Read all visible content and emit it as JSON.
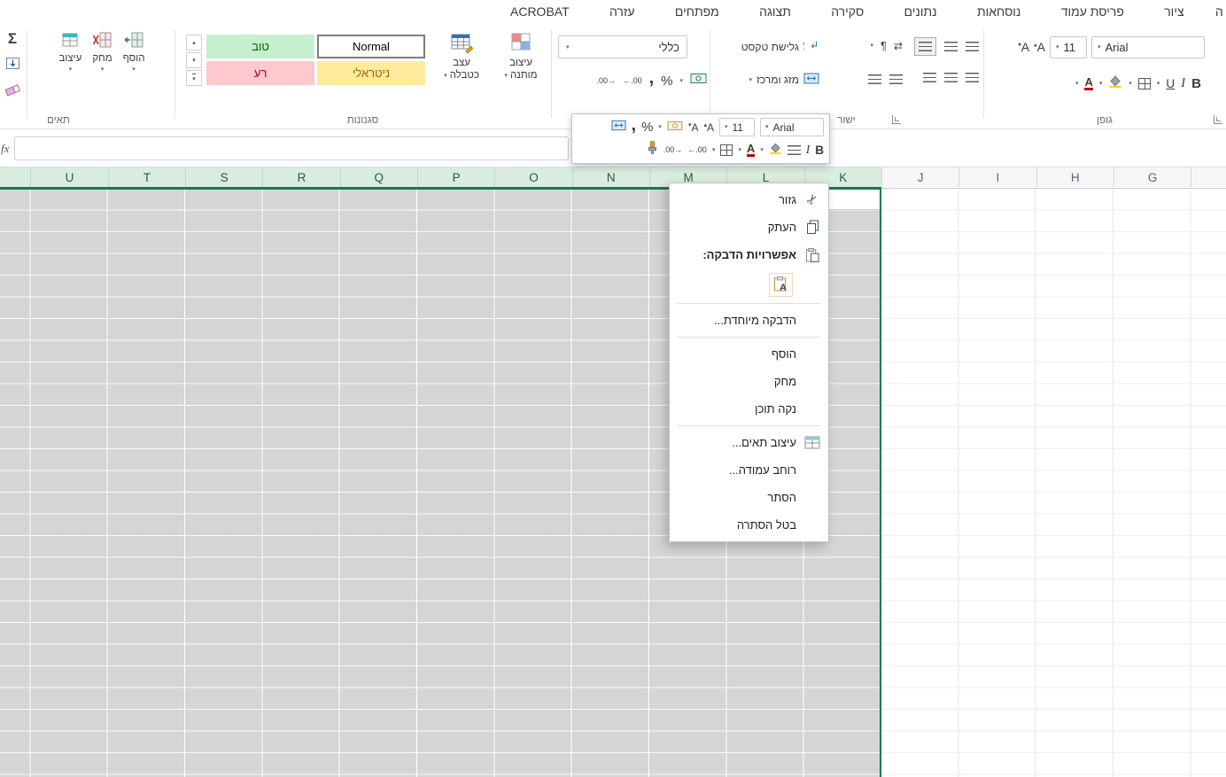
{
  "tab_bar": {
    "tabs": [
      {
        "label": "ACROBAT"
      },
      {
        "label": "עזרה"
      },
      {
        "label": "מפתחים"
      },
      {
        "label": "תצוגה"
      },
      {
        "label": "סקירה"
      },
      {
        "label": "נתונים"
      },
      {
        "label": "נוסחאות"
      },
      {
        "label": "פריסת עמוד"
      },
      {
        "label": "ציור"
      },
      {
        "label": "ה"
      }
    ]
  },
  "ribbon": {
    "editing": {
      "autosum": "Σ"
    },
    "cells": {
      "group_label": "תאים",
      "insert": "הוסף",
      "delete": "מחק",
      "format": "עיצוב"
    },
    "styles": {
      "group_label": "סגנונות",
      "good": "טוב",
      "normal": "Normal",
      "bad": "רע",
      "neutral": "ניטראלי",
      "format_table_line1": "עצב",
      "format_table_line2": "כטבלה",
      "conditional_line1": "עיצוב",
      "conditional_line2": "מותנה"
    },
    "number": {
      "format_value": "כללי",
      "percent": "%",
      "comma_glyph": ",",
      "inc_decimal": "←.00",
      "dec_decimal": ".00→"
    },
    "alignment": {
      "group_label": "ישור",
      "wrap_text": "גלישת טקסט",
      "merge_center": "מזג ומרכז",
      "pilcrow": "¶",
      "ltr_glyph": "⇄"
    },
    "font": {
      "group_label": "גופן",
      "font_name": "Arial",
      "font_size": "11",
      "bold": "B",
      "italic": "I",
      "underline": "U",
      "letter": "A"
    }
  },
  "formula_bar": {
    "fx": "fx"
  },
  "mini_toolbar": {
    "font_name": "Arial",
    "font_size": "11",
    "letter": "A",
    "percent": "%",
    "comma_glyph": ",",
    "inc_decimal": "←.00",
    "dec_decimal": ".00→",
    "bold": "B",
    "italic": "I"
  },
  "sheet": {
    "columns": [
      {
        "label": "U",
        "selected": true
      },
      {
        "label": "T",
        "selected": true
      },
      {
        "label": "S",
        "selected": true
      },
      {
        "label": "R",
        "selected": true
      },
      {
        "label": "Q",
        "selected": true
      },
      {
        "label": "P",
        "selected": true
      },
      {
        "label": "O",
        "selected": true
      },
      {
        "label": "N",
        "selected": true
      },
      {
        "label": "M",
        "selected": true
      },
      {
        "label": "L",
        "selected": true
      },
      {
        "label": "K",
        "selected": true
      },
      {
        "label": "J",
        "selected": false
      },
      {
        "label": "I",
        "selected": false
      },
      {
        "label": "H",
        "selected": false
      },
      {
        "label": "G",
        "selected": false
      }
    ]
  },
  "context_menu": {
    "items": [
      {
        "label": "גזור"
      },
      {
        "label": "העתק"
      },
      {
        "label": "אפשרויות הדבקה:"
      },
      {
        "label": "הדבקה מיוחדת..."
      },
      {
        "label": "הוסף"
      },
      {
        "label": "מחק"
      },
      {
        "label": "נקה תוכן"
      },
      {
        "label": "עיצוב תאים..."
      },
      {
        "label": "רוחב עמודה..."
      },
      {
        "label": "הסתר"
      },
      {
        "label": "בטל הסתרה"
      }
    ]
  },
  "colors": {
    "selection_green": "#177a45",
    "good_bg": "#c6efce",
    "good_text": "#006100",
    "bad_bg": "#ffc7ce",
    "bad_text": "#9c0006",
    "neutral_bg": "#ffeb9c",
    "neutral_text": "#9c6500",
    "selected_header_bg": "#d9ecdf",
    "selected_range_bg": "#d5d5d5"
  }
}
